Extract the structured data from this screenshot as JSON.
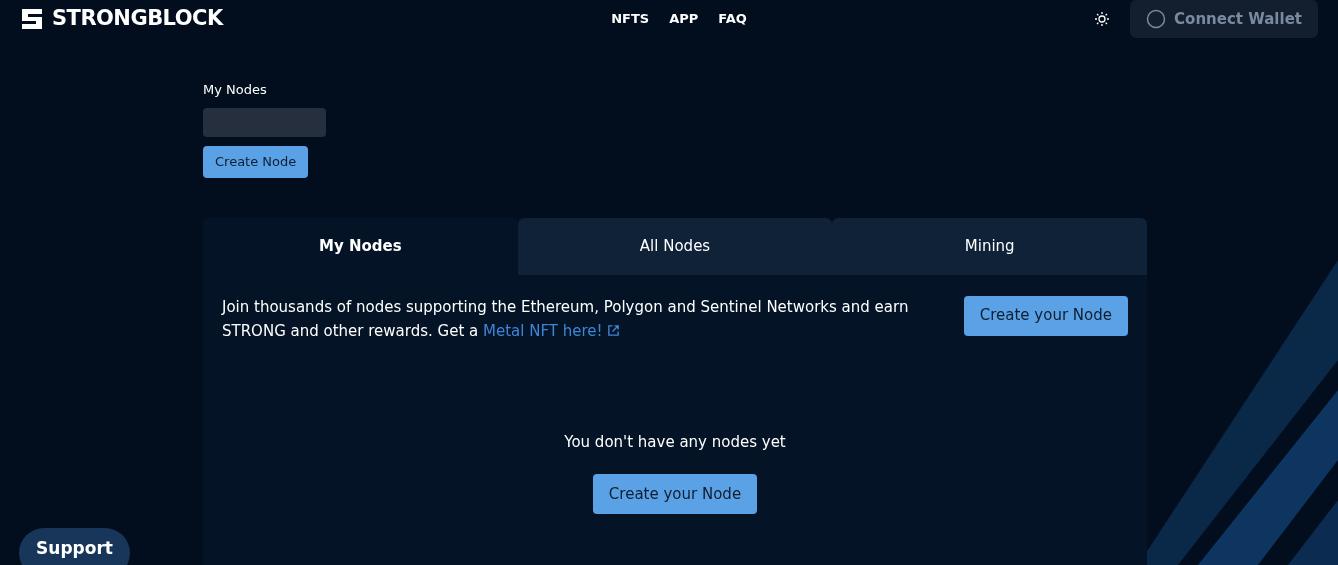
{
  "header": {
    "logo": "STRONGBLOCK",
    "nav": [
      "NFTS",
      "APP",
      "FAQ"
    ],
    "connect_button": "Connect Wallet"
  },
  "my_nodes": {
    "label": "My Nodes",
    "create_button": "Create Node"
  },
  "tabs": [
    {
      "label": "My Nodes",
      "selected": true
    },
    {
      "label": "All Nodes",
      "selected": false
    },
    {
      "label": "Mining",
      "selected": false
    }
  ],
  "panel": {
    "intro": "Join thousands of nodes supporting the Ethereum, Polygon and Sentinel Networks and earn STRONG and other rewards. Get a",
    "link": "Metal NFT here!",
    "create_button": "Create your Node",
    "empty_message": "You don't have any nodes yet",
    "empty_button": "Create your Node"
  },
  "support_button": "Support"
}
